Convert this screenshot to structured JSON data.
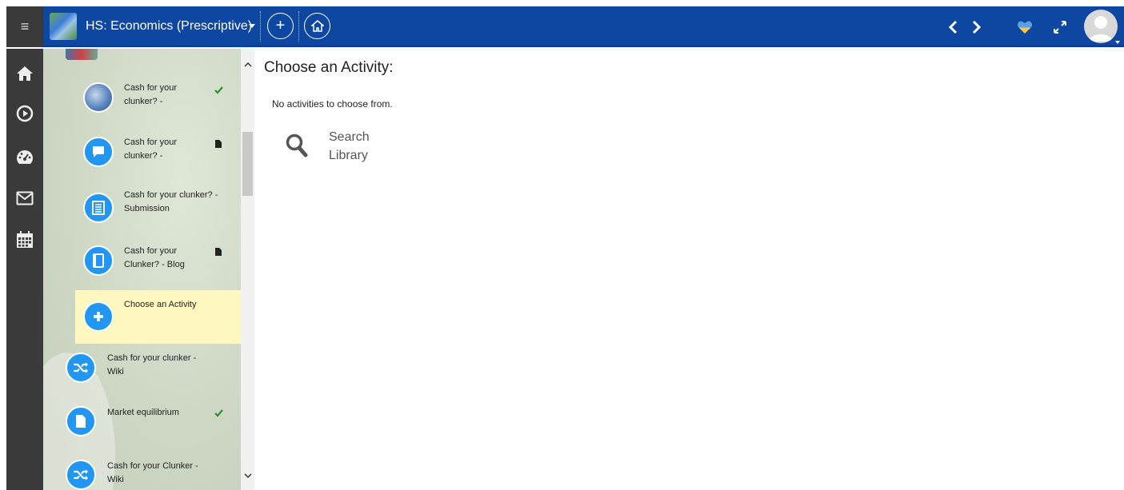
{
  "topbar": {
    "menu_glyph": "≡",
    "course_title": "HS: Economics (Prescriptive)",
    "add_glyph": "+",
    "icons": [
      "menu-icon",
      "course-thumbnail",
      "chevron-down-icon",
      "plus-icon",
      "home-icon",
      "chevron-left-icon",
      "chevron-right-icon",
      "heart-icon",
      "expand-icon",
      "avatar"
    ],
    "accent": "#0d47a1"
  },
  "rail": {
    "items": [
      {
        "name": "home",
        "icon": "home-icon"
      },
      {
        "name": "play",
        "icon": "play-circle-icon"
      },
      {
        "name": "dashboard",
        "icon": "dashboard-icon"
      },
      {
        "name": "mail",
        "icon": "envelope-icon"
      },
      {
        "name": "calendar",
        "icon": "calendar-icon"
      }
    ]
  },
  "activities": [
    {
      "label": "Cash for your clunker? -",
      "icon": "photo-thumbnail",
      "status": "check-icon"
    },
    {
      "label": "Cash for your clunker? -",
      "icon": "chat-bubble-icon",
      "status": "file-icon"
    },
    {
      "label": "Cash for your clunker? - Submission",
      "icon": "list-document-icon",
      "status": ""
    },
    {
      "label": "Cash for your Clunker? - Blog",
      "icon": "book-icon",
      "status": "file-icon"
    },
    {
      "label": "Choose an Activity",
      "icon": "plus-icon",
      "status": "",
      "selected": true
    },
    {
      "label": "Cash for your clunker - Wiki",
      "icon": "shuffle-icon",
      "status": ""
    },
    {
      "label": "Market equilibrium",
      "icon": "document-icon",
      "status": "check-icon"
    },
    {
      "label": "Cash for your Clunker - Wiki",
      "icon": "shuffle-icon",
      "status": ""
    }
  ],
  "main": {
    "heading": "Choose an Activity:",
    "empty_message": "No activities to choose from.",
    "search_library_label": "Search Library"
  },
  "colors": {
    "activity_blue": "#2196f3",
    "selected_bg": "#fff7c0",
    "check_green": "#2e8b2e"
  }
}
